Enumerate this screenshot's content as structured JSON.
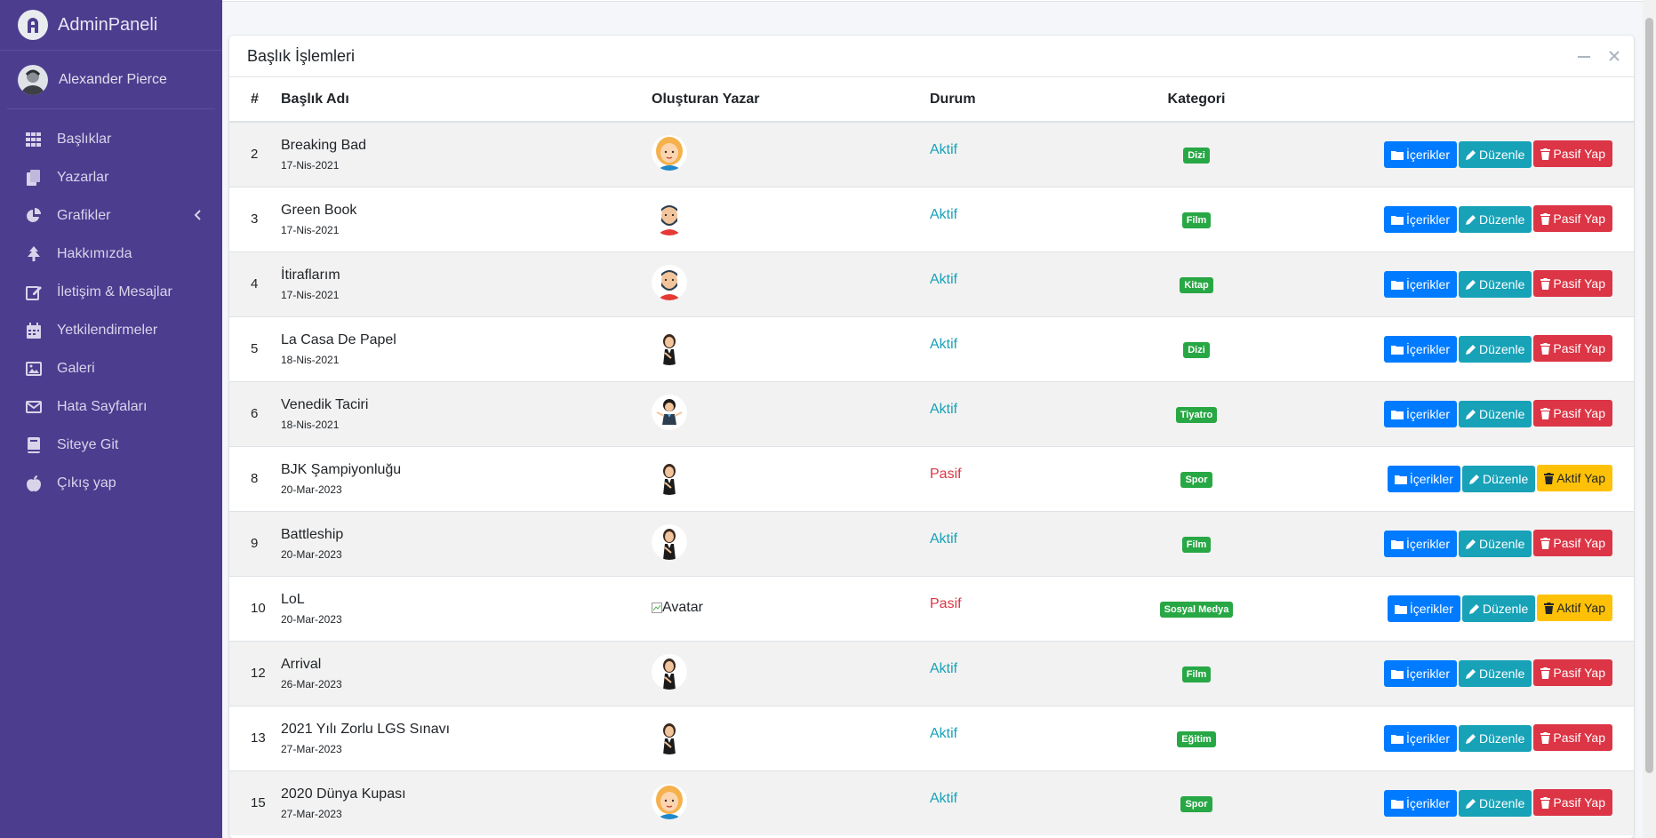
{
  "brand": {
    "name": "AdminPaneli"
  },
  "user": {
    "name": "Alexander Pierce"
  },
  "sidebar": {
    "items": [
      {
        "label": "Başlıklar",
        "icon": "grid-icon"
      },
      {
        "label": "Yazarlar",
        "icon": "copy-icon"
      },
      {
        "label": "Grafikler",
        "icon": "pie-chart-icon"
      },
      {
        "label": "Hakkımızda",
        "icon": "tree-icon"
      },
      {
        "label": "İletişim & Mesajlar",
        "icon": "edit-icon"
      },
      {
        "label": "Yetkilendirmeler",
        "icon": "calendar-icon"
      },
      {
        "label": "Galeri",
        "icon": "image-icon"
      },
      {
        "label": "Hata Sayfaları",
        "icon": "envelope-icon"
      },
      {
        "label": "Siteye Git",
        "icon": "book-icon"
      },
      {
        "label": "Çıkış yap",
        "icon": "apple-icon"
      }
    ]
  },
  "card": {
    "title": "Başlık İşlemleri"
  },
  "table": {
    "headers": {
      "num": "#",
      "title": "Başlık Adı",
      "author": "Oluşturan Yazar",
      "status": "Durum",
      "category": "Kategori"
    },
    "buttons": {
      "contents": "İçerikler",
      "edit": "Düzenle",
      "deactivate": "Pasif Yap",
      "activate": "Aktif Yap"
    },
    "broken_avatar_alt": "Avatar",
    "rows": [
      {
        "num": "2",
        "title": "Breaking Bad",
        "date": "17-Nis-2021",
        "avatar": "blonde-woman",
        "status": "Aktif",
        "active": true,
        "category": "Dizi"
      },
      {
        "num": "3",
        "title": "Green Book",
        "date": "17-Nis-2021",
        "avatar": "bearded-man",
        "status": "Aktif",
        "active": true,
        "category": "Film"
      },
      {
        "num": "4",
        "title": "İtiraflarım",
        "date": "17-Nis-2021",
        "avatar": "bearded-man",
        "status": "Aktif",
        "active": true,
        "category": "Kitap"
      },
      {
        "num": "5",
        "title": "La Casa De Papel",
        "date": "18-Nis-2021",
        "avatar": "business-woman",
        "status": "Aktif",
        "active": true,
        "category": "Dizi"
      },
      {
        "num": "6",
        "title": "Venedik Taciri",
        "date": "18-Nis-2021",
        "avatar": "shrug-woman",
        "status": "Aktif",
        "active": true,
        "category": "Tiyatro"
      },
      {
        "num": "8",
        "title": "BJK Şampiyonluğu",
        "date": "20-Mar-2023",
        "avatar": "business-woman",
        "status": "Pasif",
        "active": false,
        "category": "Spor"
      },
      {
        "num": "9",
        "title": "Battleship",
        "date": "20-Mar-2023",
        "avatar": "business-woman",
        "status": "Aktif",
        "active": true,
        "category": "Film"
      },
      {
        "num": "10",
        "title": "LoL",
        "date": "20-Mar-2023",
        "avatar": "broken",
        "status": "Pasif",
        "active": false,
        "category": "Sosyal Medya"
      },
      {
        "num": "12",
        "title": "Arrival",
        "date": "26-Mar-2023",
        "avatar": "business-woman",
        "status": "Aktif",
        "active": true,
        "category": "Film"
      },
      {
        "num": "13",
        "title": "2021 Yılı Zorlu LGS Sınavı",
        "date": "27-Mar-2023",
        "avatar": "business-woman",
        "status": "Aktif",
        "active": true,
        "category": "Eğitim"
      },
      {
        "num": "15",
        "title": "2020 Dünya Kupası",
        "date": "27-Mar-2023",
        "avatar": "blonde-woman",
        "status": "Aktif",
        "active": true,
        "category": "Spor"
      }
    ]
  },
  "colors": {
    "sidebar": "#4c3d8f",
    "active": "#17a2b8",
    "passive": "#dc3545",
    "badge": "#28a745"
  }
}
